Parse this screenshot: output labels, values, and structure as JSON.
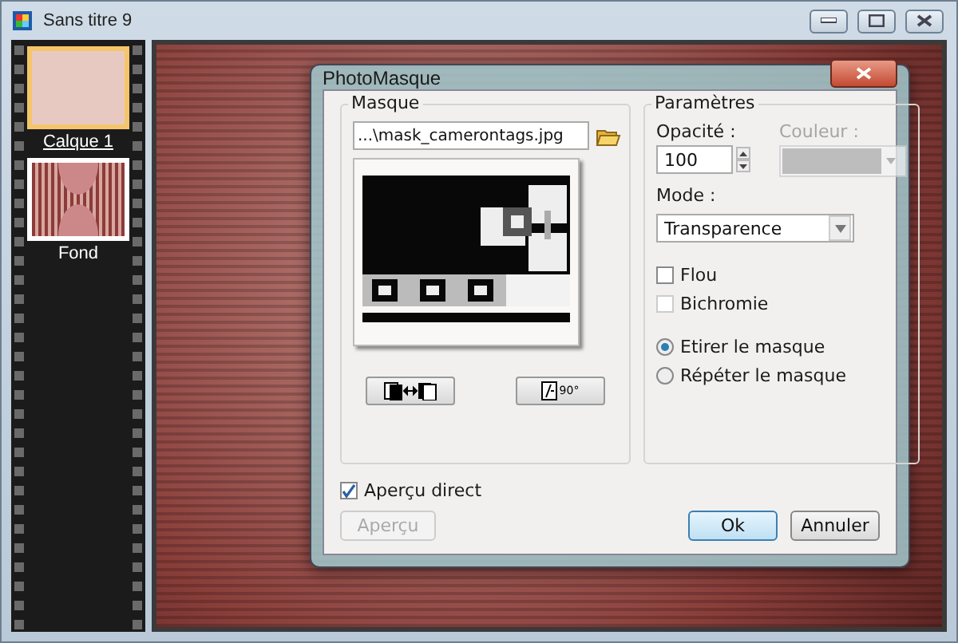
{
  "window": {
    "title": "Sans titre 9"
  },
  "layers": [
    {
      "name": "Calque 1",
      "selected": true,
      "kind": "plain"
    },
    {
      "name": "Fond",
      "selected": false,
      "kind": "pattern"
    }
  ],
  "dialog": {
    "title": "PhotoMasque",
    "mask_group": {
      "label": "Masque",
      "file_path": "...\\mask_camerontags.jpg",
      "rotate_label": "90°"
    },
    "params": {
      "label": "Paramètres",
      "opacity_label": "Opacité :",
      "opacity_value": "100",
      "color_label": "Couleur :",
      "color_disabled": true,
      "mode_label": "Mode :",
      "mode_value": "Transparence",
      "checkboxes": [
        {
          "label": "Flou",
          "checked": false,
          "disabled": false
        },
        {
          "label": "Bichromie",
          "checked": false,
          "disabled": true
        }
      ],
      "radios": [
        {
          "label": "Etirer le masque",
          "selected": true
        },
        {
          "label": "Répéter le masque",
          "selected": false
        }
      ]
    },
    "live_preview": {
      "label": "Aperçu direct",
      "checked": true
    },
    "buttons": [
      {
        "label": "Aperçu",
        "disabled": true,
        "default": false
      },
      {
        "label": "Ok",
        "disabled": false,
        "default": true
      },
      {
        "label": "Annuler",
        "disabled": false,
        "default": false
      }
    ]
  }
}
